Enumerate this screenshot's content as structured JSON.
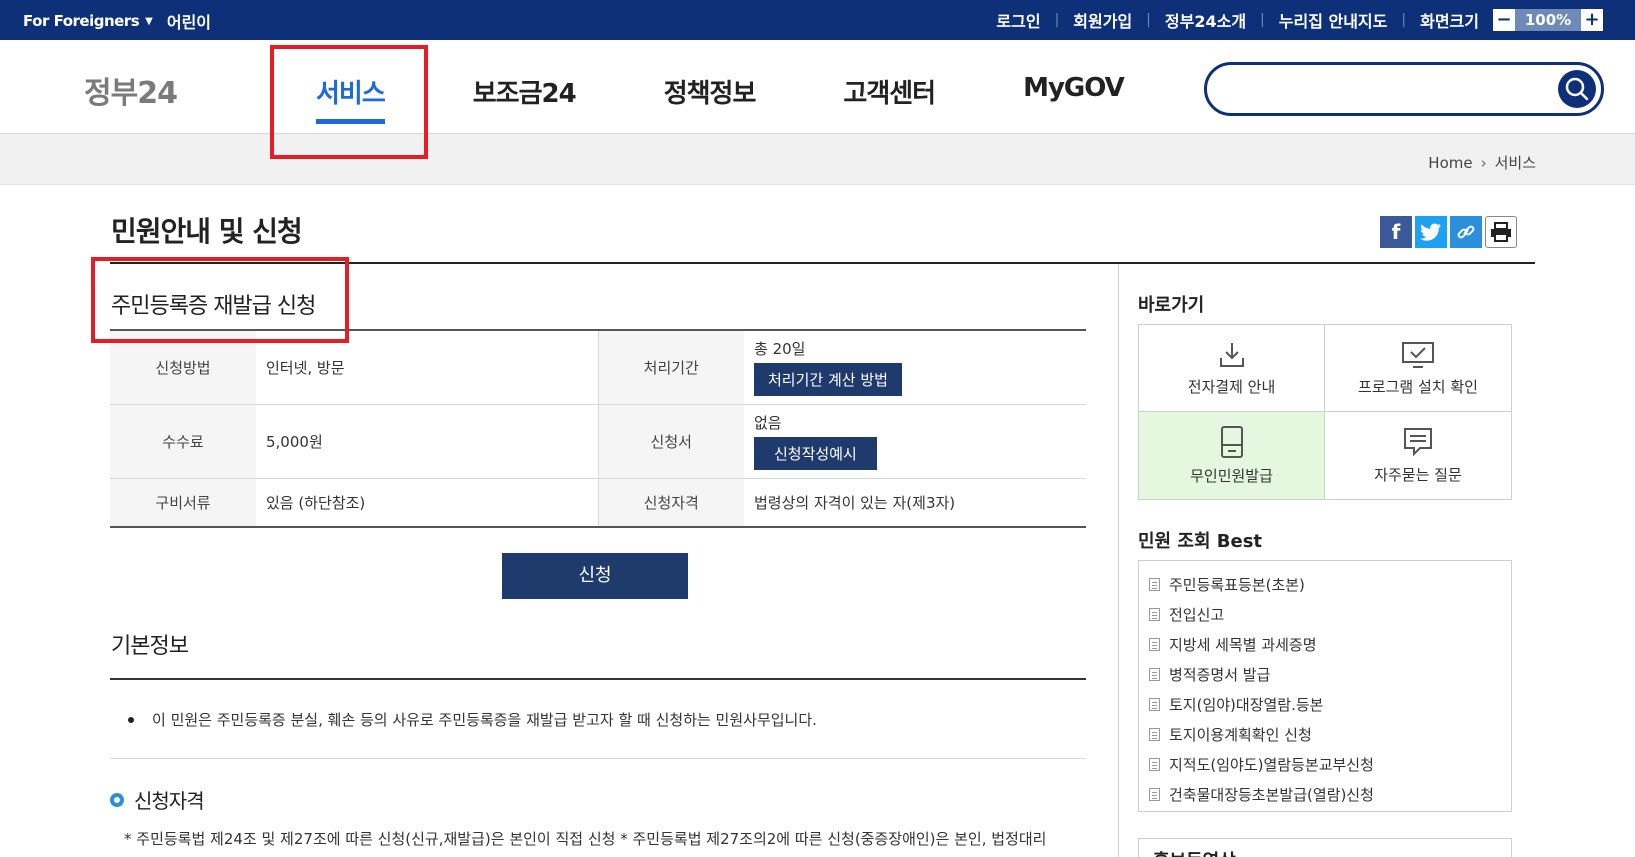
{
  "topbar": {
    "foreigners": "For Foreigners",
    "kids": "어린이",
    "links": [
      "로그인",
      "회원가입",
      "정부24소개",
      "누리집 안내지도"
    ],
    "screen_size_label": "화면크기",
    "zoom_minus": "−",
    "zoom_value": "100%",
    "zoom_plus": "+"
  },
  "header": {
    "logo": "정부24",
    "nav": [
      "서비스",
      "보조금24",
      "정책정보",
      "고객센터",
      "MyGOV"
    ],
    "active_nav": "서비스",
    "search_placeholder": ""
  },
  "breadcrumb": {
    "home": "Home",
    "current": "서비스"
  },
  "page": {
    "title": "민원안내 및 신청",
    "subtitle": "주민등록증 재발급 신청"
  },
  "info": {
    "method_label": "신청방법",
    "method_value": "인터넷, 방문",
    "period_label": "처리기간",
    "period_value": "총 20일",
    "period_button": "처리기간 계산 방법",
    "fee_label": "수수료",
    "fee_value": "5,000원",
    "form_label": "신청서",
    "form_value": "없음",
    "form_button": "신청작성예시",
    "docs_label": "구비서류",
    "docs_value": "있음 (하단참조)",
    "qual_label": "신청자격",
    "qual_value": "법령상의 자격이 있는 자(제3자)"
  },
  "apply_button": "신청",
  "basic": {
    "title": "기본정보",
    "bullet": "이 민원은 주민등록증 분실, 훼손 등의 사유로 주민등록증을 재발급 받고자 할 때 신청하는 민원사무입니다.",
    "qual_title": "신청자격",
    "qual_text": "* 주민등록법 제24조 및 제27조에 따른 신청(신규,재발급)은 본인이 직접 신청 * 주민등록법 제27조의2에 따른 신청(중증장애인)은 본인, 법정대리"
  },
  "sidebar": {
    "quick_title": "바로가기",
    "quick": [
      "전자결제 안내",
      "프로그램 설치 확인",
      "무인민원발급",
      "자주묻는 질문"
    ],
    "best_title": "민원 조회 Best",
    "best": [
      "주민등록표등본(초본)",
      "전입신고",
      "지방세 세목별 과세증명",
      "병적증명서 발급",
      "토지(임야)대장열람.등본",
      "토지이용계획확인 신청",
      "지적도(임야도)열람등본교부신청",
      "건축물대장등초본발급(열람)신청"
    ],
    "promo_title": "홍보동영상"
  },
  "colors": {
    "navy": "#0d3079",
    "accent_blue": "#1d6ad9",
    "button": "#1f3b6e",
    "highlight_red": "#e51e25",
    "green_cell": "#e3f8df"
  }
}
